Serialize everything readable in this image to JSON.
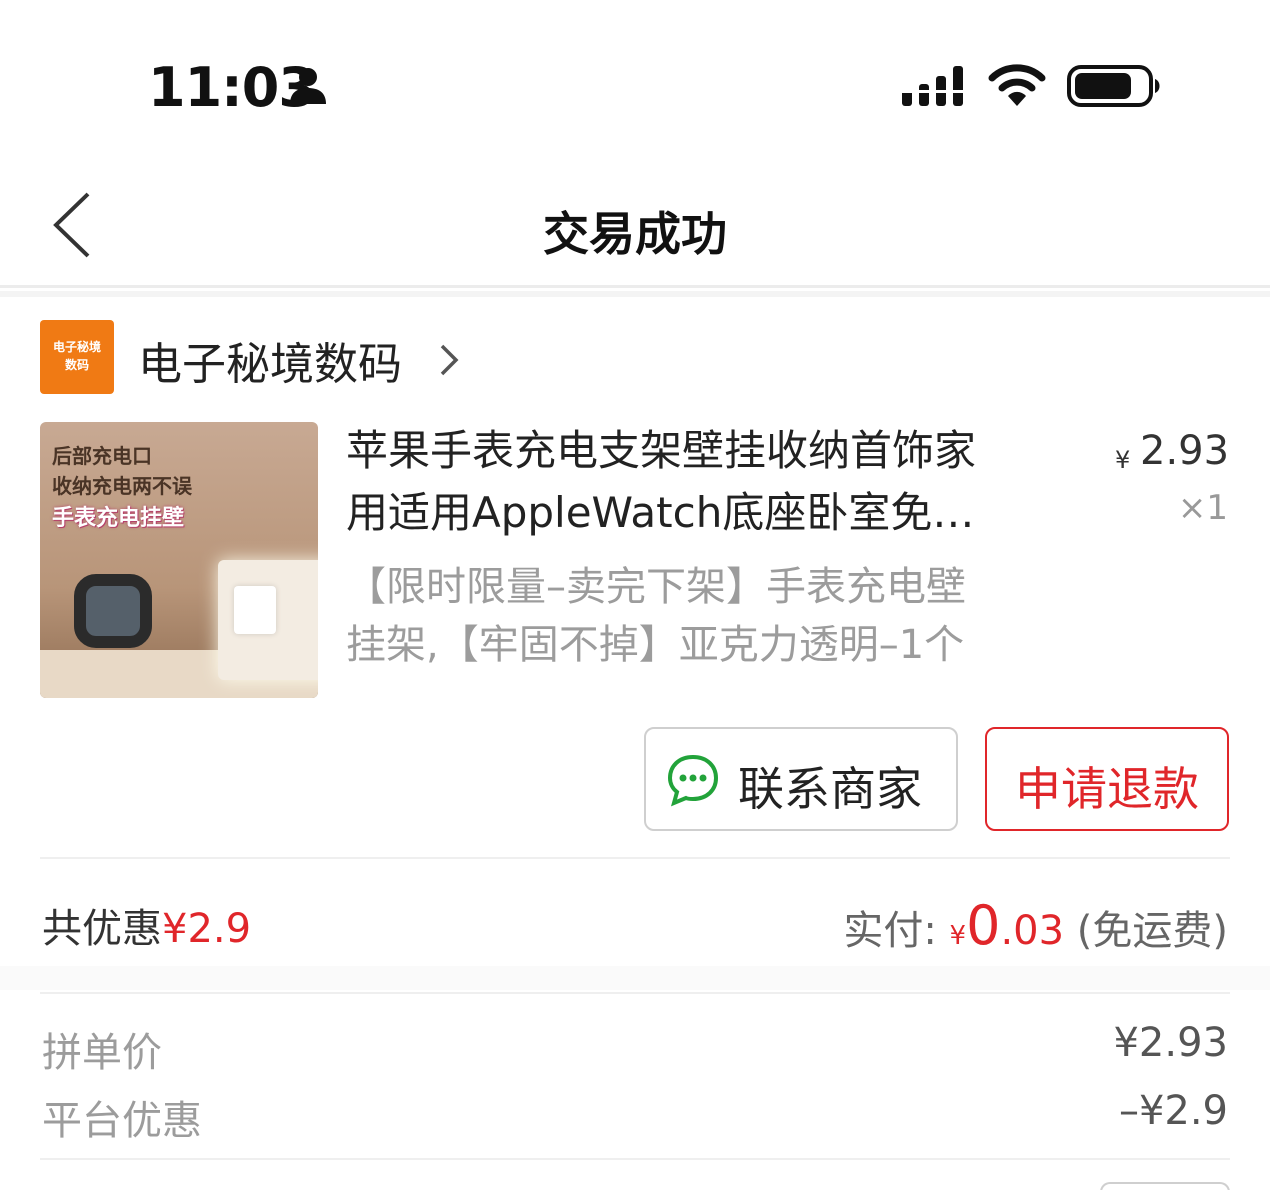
{
  "status_bar": {
    "time": "11:03",
    "icons": [
      "person-icon",
      "signal-icon",
      "wifi-icon",
      "battery-icon"
    ]
  },
  "nav": {
    "title": "交易成功",
    "back_icon": "chevron-left-icon"
  },
  "shop": {
    "logo_text_line1": "电子秘境",
    "logo_text_line2": "数码",
    "name": "电子秘境数码",
    "chevron_icon": "chevron-right-icon"
  },
  "product": {
    "image_text_line1": "后部充电口",
    "image_text_line2": "收纳充电两不误",
    "image_text_line3": "手表充电挂壁",
    "title_line1": "苹果手表充电支架壁挂收纳首饰家",
    "title_line2": "用适用AppleWatch底座卧室免…",
    "price_symbol": "¥",
    "price": "2.93",
    "quantity": "×1",
    "spec_line1": "【限时限量–卖完下架】手表充电壁",
    "spec_line2": "挂架,【牢固不掉】亚克力透明–1个"
  },
  "actions": {
    "contact_label": "联系商家",
    "refund_label": "申请退款"
  },
  "summary": {
    "discount_label": "共优惠",
    "discount_amount": "¥2.9",
    "paid_label": "实付:",
    "paid_symbol": "¥",
    "paid_integer": "0",
    "paid_decimal": ".03",
    "shipping_note": "(免运费)"
  },
  "breakdown": [
    {
      "label": "拼单价",
      "value": "¥2.93"
    },
    {
      "label": "平台优惠",
      "value": "–¥2.9"
    }
  ],
  "colors": {
    "accent_red": "#e0262a",
    "shop_logo_orange": "#f07a14",
    "chat_green": "#22a33a"
  }
}
